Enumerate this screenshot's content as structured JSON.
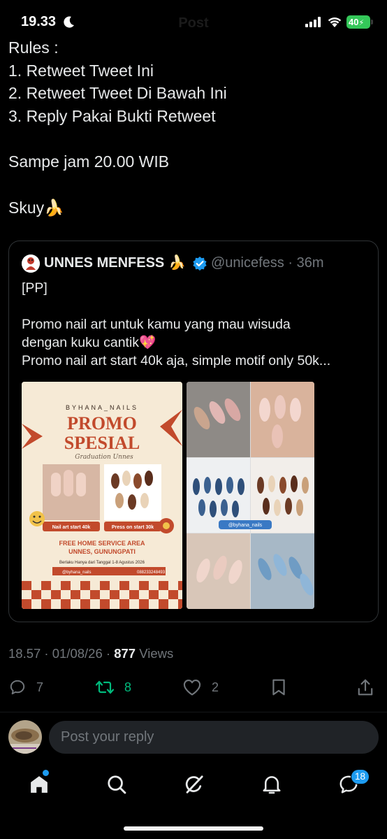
{
  "status_bar": {
    "time": "19.33",
    "title": "Post",
    "battery": "40"
  },
  "tweet": {
    "lines": [
      "Rules :",
      "1. Retweet Tweet Ini",
      "2. Retweet Tweet Di Bawah Ini",
      "3. Reply Pakai Bukti Retweet",
      "",
      "Sampe jam 20.00 WIB",
      "",
      "Skuy🍌"
    ]
  },
  "quote": {
    "name": "UNNES MENFESS",
    "handle": "@unicefess · 36m",
    "lines": [
      "[PP]",
      "",
      "Promo nail art untuk kamu yang mau wisuda",
      "dengan kuku cantik💖",
      "Promo nail art start 40k aja, simple motif only 50k..."
    ],
    "poster": {
      "brand": "BYHANA_NAILS",
      "title_1": "PROMO",
      "title_2": "SPESIAL",
      "script": "Graduation Unnes",
      "price_1": "Nail art start 40k",
      "price_2": "Press on start 30k",
      "service_1": "FREE HOME SERVICE AREA",
      "service_2": "UNNES, GUNUNGPATI",
      "validity": "Berlaku Hanya dari Tanggal 1-8 Agustus 2026",
      "instagram": "@byhana_nails",
      "phone": "088233248493"
    },
    "photo_watermark": "@byhana_nails"
  },
  "meta": {
    "time_date": "18.57 · 01/08/26 · ",
    "views_count": "877",
    "views_label": " Views"
  },
  "actions": {
    "replies": "7",
    "retweets": "8",
    "likes": "2"
  },
  "reply": {
    "placeholder": "Post your reply"
  },
  "nav": {
    "messages_badge": "18"
  },
  "colors": {
    "background": "#000000",
    "text": "#e7e9ea",
    "muted": "#71767b",
    "accent": "#1d9bf0",
    "retweet_active": "#00ba7c",
    "poster_red": "#c24a2c"
  },
  "icons": [
    "moon-icon",
    "signal-icon",
    "wifi-icon",
    "battery-icon",
    "verified-badge-icon",
    "reply-icon",
    "retweet-icon",
    "like-icon",
    "bookmark-icon",
    "share-icon",
    "home-icon",
    "search-icon",
    "grok-icon",
    "notifications-icon",
    "messages-icon"
  ]
}
